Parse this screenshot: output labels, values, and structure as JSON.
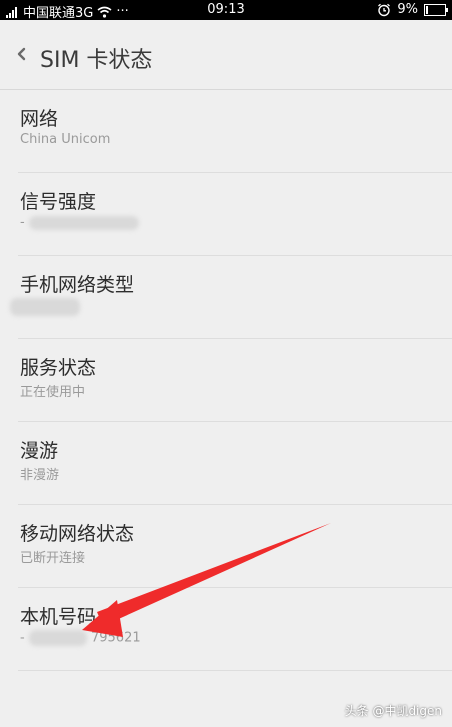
{
  "status_bar": {
    "carrier": "中国联通3G",
    "more": "···",
    "time": "09:13",
    "battery": "9%",
    "battery_level": 0.09
  },
  "header": {
    "title": "SIM 卡状态"
  },
  "items": [
    {
      "title": "网络",
      "value": "China Unicom"
    },
    {
      "title": "信号强度",
      "value": "-"
    },
    {
      "title": "手机网络类型",
      "value": ""
    },
    {
      "title": "服务状态",
      "value": "正在使用中"
    },
    {
      "title": "漫游",
      "value": "非漫游"
    },
    {
      "title": "移动网络状态",
      "value": "已断开连接"
    },
    {
      "title": "本机号码",
      "value": "-",
      "value_suffix": "795621"
    }
  ],
  "annotation": {
    "color": "#ef2b2b"
  },
  "watermark": "头条 @中凯digen"
}
